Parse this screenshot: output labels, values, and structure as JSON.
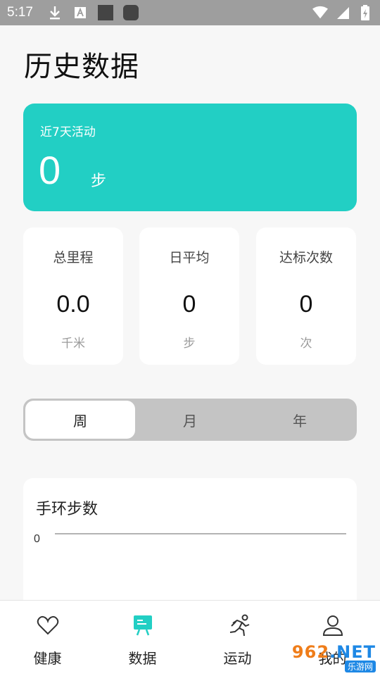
{
  "status_bar": {
    "time": "5:17"
  },
  "page": {
    "title": "历史数据"
  },
  "activity": {
    "label": "近7天活动",
    "value": "0",
    "unit": "步"
  },
  "stats": [
    {
      "label": "总里程",
      "value": "0.0",
      "unit": "千米"
    },
    {
      "label": "日平均",
      "value": "0",
      "unit": "步"
    },
    {
      "label": "达标次数",
      "value": "0",
      "unit": "次"
    }
  ],
  "period_tabs": [
    {
      "label": "周",
      "selected": true
    },
    {
      "label": "月",
      "selected": false
    },
    {
      "label": "年",
      "selected": false
    }
  ],
  "chart_card": {
    "title": "手环步数"
  },
  "chart_data": {
    "type": "line",
    "title": "手环步数",
    "y_ticks": [
      "0"
    ],
    "series": [],
    "grid": false
  },
  "tabbar": {
    "items": [
      {
        "label": "健康",
        "icon": "heart-icon",
        "active": false
      },
      {
        "label": "数据",
        "icon": "chart-board-icon",
        "active": true
      },
      {
        "label": "运动",
        "icon": "runner-icon",
        "active": false
      },
      {
        "label": "我的",
        "icon": "person-icon",
        "active": false
      }
    ]
  },
  "watermark": {
    "main": "962",
    "net": ".NET",
    "sub": "乐游网"
  },
  "colors": {
    "accent": "#22cfc4",
    "status_bar": "#9e9e9e",
    "page_bg": "#f7f7f7"
  }
}
